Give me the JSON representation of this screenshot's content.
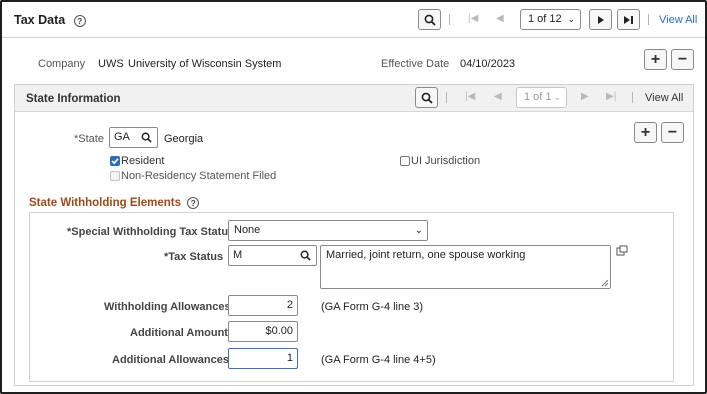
{
  "header": {
    "title": "Tax Data",
    "pager": "1 of 12",
    "view_all": "View All"
  },
  "company": {
    "label": "Company",
    "code": "UWS",
    "name": "University of Wisconsin System"
  },
  "effective_date": {
    "label": "Effective Date",
    "value": "04/10/2023"
  },
  "state_info": {
    "title": "State Information",
    "pager": "1 of 1",
    "view_all": "View All",
    "state_label": "*State",
    "state_value": "GA",
    "state_name": "Georgia",
    "resident_label": "Resident",
    "ui_jurisdiction_label": "UI Jurisdiction",
    "non_residency_label": "Non-Residency Statement Filed"
  },
  "withholding": {
    "title": "State Withholding Elements",
    "special_status_label": "*Special Withholding Tax Status",
    "special_status_value": "None",
    "tax_status_label": "*Tax Status",
    "tax_status_value": "M",
    "tax_status_desc": "Married, joint return, one spouse working",
    "allowances_label": "Withholding Allowances",
    "allowances_value": "2",
    "allowances_note": "(GA Form G-4 line 3)",
    "additional_amount_label": "Additional Amount",
    "additional_amount_value": "$0.00",
    "additional_allowances_label": "Additional Allowances",
    "additional_allowances_value": "1",
    "additional_allowances_note": "(GA Form G-4 line 4+5)"
  },
  "colors": {
    "section_title": "#9b4a1c",
    "link": "#2a6fbd",
    "panel_header": "#f1f1f1"
  }
}
